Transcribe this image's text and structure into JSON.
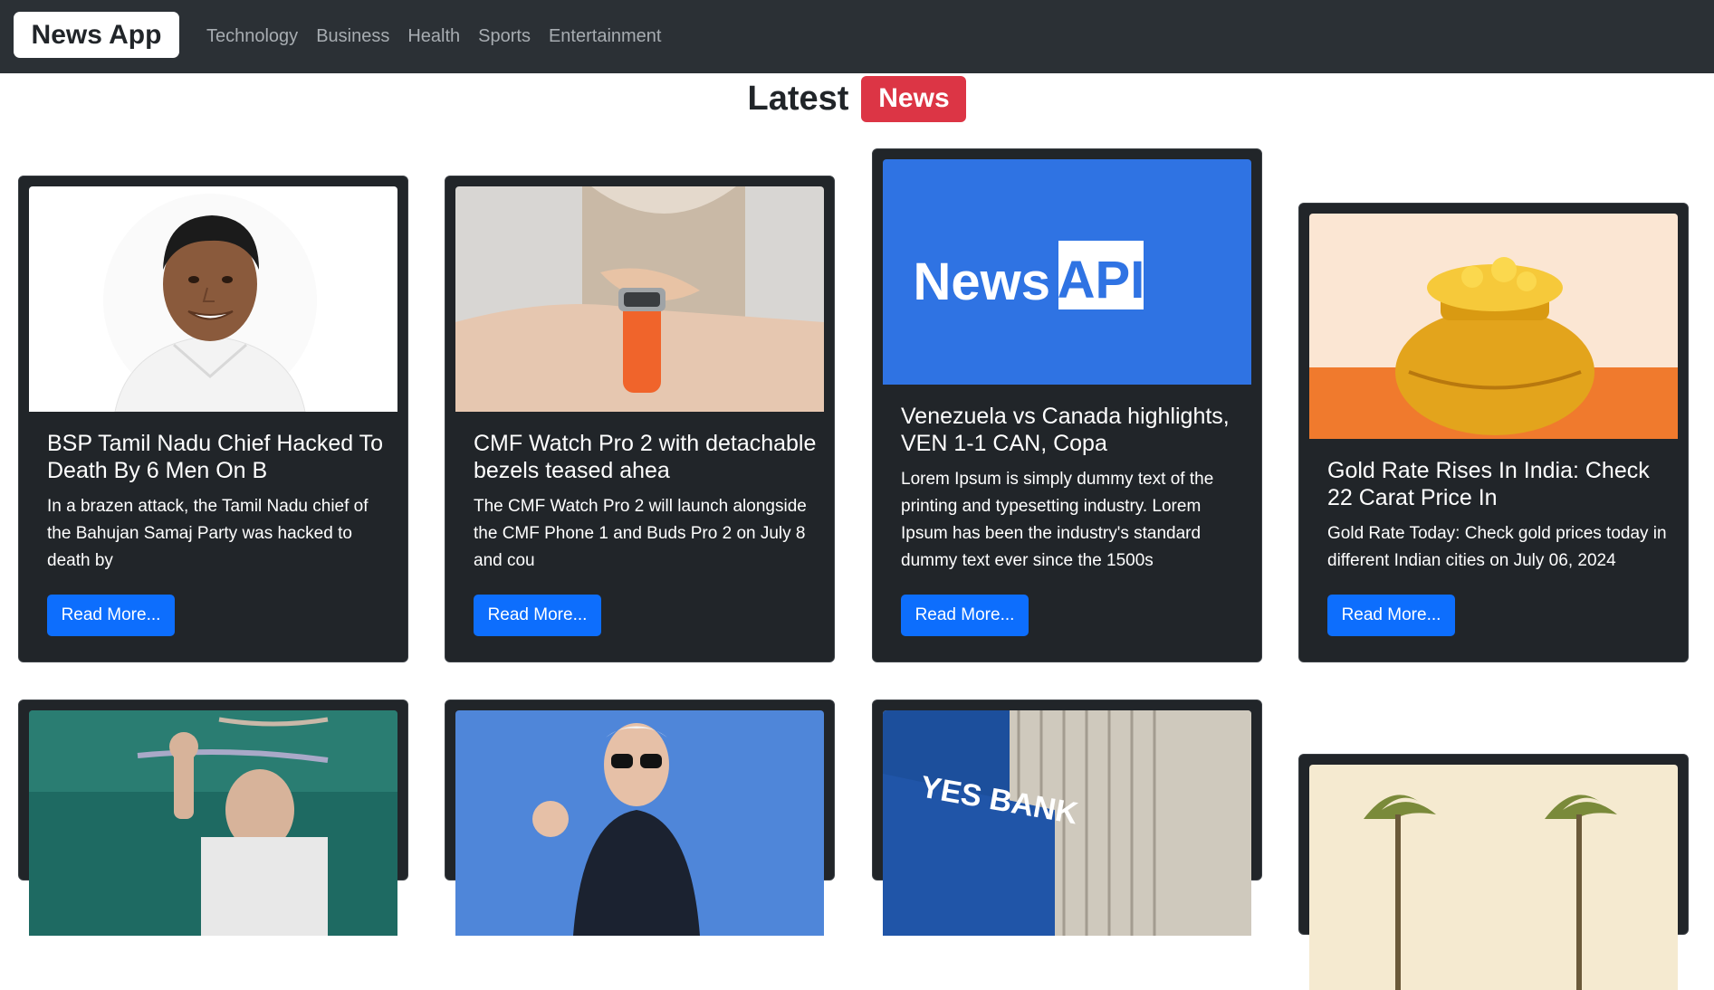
{
  "navbar": {
    "brand": "News App",
    "links": [
      "Technology",
      "Business",
      "Health",
      "Sports",
      "Entertainment"
    ]
  },
  "heading": {
    "text": "Latest",
    "badge": "News"
  },
  "colors": {
    "navbar": "#2b3035",
    "card": "#212529",
    "badge": "#dc3545",
    "button": "#0d6efd",
    "api_blue": "#2f73e3"
  },
  "cards": [
    {
      "image": "portrait-photo",
      "title": "BSP Tamil Nadu Chief Hacked To Death By 6 Men On B",
      "description": "In a brazen attack, the Tamil Nadu chief of the Bahujan Samaj Party was hacked to death by",
      "button": "Read More..."
    },
    {
      "image": "smartwatch-photo",
      "title": "CMF Watch Pro 2 with detachable bezels teased ahea",
      "description": "The CMF Watch Pro 2 will launch alongside the CMF Phone 1 and Buds Pro 2 on July 8 and cou",
      "button": "Read More..."
    },
    {
      "image": "newsapi-logo",
      "logo_text_1": "News",
      "logo_text_2": "API",
      "title": "Venezuela vs Canada highlights, VEN 1-1 CAN, Copa",
      "description": "Lorem Ipsum is simply dummy text of the printing and typesetting industry. Lorem Ipsum has been the industry's standard dummy text ever since the 1500s",
      "button": "Read More..."
    },
    {
      "image": "gold-pot-illustration",
      "title": "Gold Rate Rises In India: Check 22 Carat Price In",
      "description": "Gold Rate Today: Check gold prices today in different Indian cities on July 06, 2024",
      "button": "Read More..."
    },
    {
      "image": "rally-photo"
    },
    {
      "image": "president-photo"
    },
    {
      "image": "bank-building-photo",
      "sign_text": "YES BANK"
    },
    {
      "image": "palm-trees-illustration"
    }
  ]
}
